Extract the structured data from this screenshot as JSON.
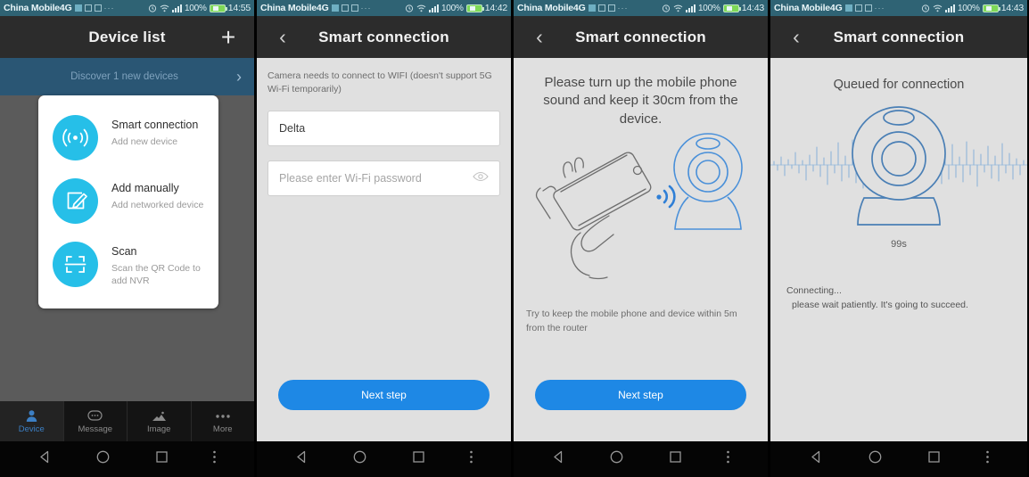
{
  "colors": {
    "statusbar_bg": "#2f6374",
    "titlebar_bg": "#2c2c2c",
    "accent_cyan": "#26bfe8",
    "accent_blue": "#1e88e5",
    "screen_bg": "#e0e0e0",
    "overlay_bg": "#5b5b5b",
    "discover_bg": "#2a5674",
    "battery_green": "#7ed957",
    "tab_active_blue": "#3c7fc4"
  },
  "statusbar": {
    "carrier": "China Mobile4G",
    "battery_pct": "100%",
    "icons": [
      "message-icon",
      "app-icon",
      "overflow-icon",
      "alarm-icon",
      "wifi-icon",
      "signal-icon",
      "battery-icon"
    ]
  },
  "panels": [
    {
      "id": "device-list",
      "time": "14:55",
      "title": "Device list",
      "add_label": "+",
      "discover_banner": "Discover  1  new devices",
      "menu": [
        {
          "title": "Smart connection",
          "subtitle": "Add new device",
          "icon": "broadcast-icon"
        },
        {
          "title": "Add manually",
          "subtitle": "Add networked device",
          "icon": "edit-square-icon"
        },
        {
          "title": "Scan",
          "subtitle": "Scan the QR Code to add NVR",
          "icon": "scan-frame-icon"
        }
      ],
      "tabs": [
        {
          "label": "Device",
          "icon": "person-icon",
          "active": true
        },
        {
          "label": "Message",
          "icon": "chat-icon",
          "active": false
        },
        {
          "label": "Image",
          "icon": "image-icon",
          "active": false
        },
        {
          "label": "More",
          "icon": "more-dots-icon",
          "active": false
        }
      ]
    },
    {
      "id": "wifi-setup",
      "time": "14:42",
      "title": "Smart connection",
      "hint": "Camera needs to connect to WIFI (doesn't support 5G Wi-Fi temporarily)",
      "ssid_value": "Delta",
      "password_placeholder": "Please enter Wi-Fi password",
      "next_label": "Next step"
    },
    {
      "id": "sound-pairing",
      "time": "14:43",
      "title": "Smart connection",
      "instruction": "Please turn up the mobile phone sound and keep it 30cm from the device.",
      "footnote": "Try to keep the mobile phone and device within 5m from the router",
      "next_label": "Next step"
    },
    {
      "id": "connecting",
      "time": "14:43",
      "title": "Smart connection",
      "status": "Queued for connection",
      "countdown": "99s",
      "connecting_line1": "Connecting...",
      "connecting_line2": "please wait patiently. It's going to succeed."
    }
  ],
  "navbar": {
    "back": "back-icon",
    "home": "home-icon",
    "recents": "recents-icon",
    "menu": "menu-icon"
  }
}
